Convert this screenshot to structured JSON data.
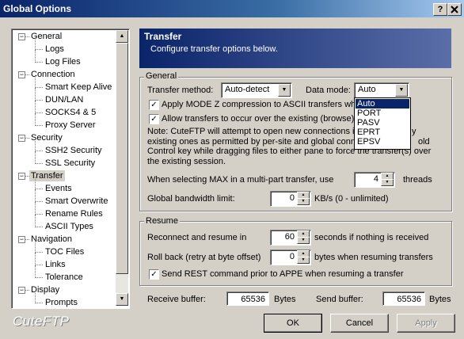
{
  "window": {
    "title": "Global Options",
    "help_glyph": "?",
    "close_glyph": "X"
  },
  "tree": {
    "items": [
      {
        "label": "General",
        "level": 0,
        "expander": "−"
      },
      {
        "label": "Logs",
        "level": 1
      },
      {
        "label": "Log Files",
        "level": 1
      },
      {
        "label": "Connection",
        "level": 0,
        "expander": "−"
      },
      {
        "label": "Smart Keep Alive",
        "level": 1
      },
      {
        "label": "DUN/LAN",
        "level": 1
      },
      {
        "label": "SOCKS4 & 5",
        "level": 1
      },
      {
        "label": "Proxy Server",
        "level": 1
      },
      {
        "label": "Security",
        "level": 0,
        "expander": "−"
      },
      {
        "label": "SSH2 Security",
        "level": 1
      },
      {
        "label": "SSL Security",
        "level": 1
      },
      {
        "label": "Transfer",
        "level": 0,
        "expander": "−",
        "selected": true
      },
      {
        "label": "Events",
        "level": 1
      },
      {
        "label": "Smart Overwrite",
        "level": 1
      },
      {
        "label": "Rename Rules",
        "level": 1
      },
      {
        "label": "ASCII Types",
        "level": 1
      },
      {
        "label": "Navigation",
        "level": 0,
        "expander": "−"
      },
      {
        "label": "TOC Files",
        "level": 1
      },
      {
        "label": "Links",
        "level": 1
      },
      {
        "label": "Tolerance",
        "level": 1
      },
      {
        "label": "Display",
        "level": 0,
        "expander": "−"
      },
      {
        "label": "Prompts",
        "level": 1
      }
    ]
  },
  "brand": "CuteFTP",
  "banner": {
    "title": "Transfer",
    "subtitle": "Configure transfer options below."
  },
  "general": {
    "legend": "General",
    "transfer_method_label": "Transfer method:",
    "transfer_method_value": "Auto-detect",
    "data_mode_label": "Data mode:",
    "data_mode_value": "Auto",
    "data_mode_options": [
      "Auto",
      "PORT",
      "PASV",
      "EPRT",
      "EPSV"
    ],
    "mode_z_label": "Apply MODE Z compression to ASCII transfers whe",
    "mode_z_checked": true,
    "allow_transfers_label": "Allow transfers to occur over the existing (browse)",
    "allow_transfers_checked": true,
    "note_lines": [
      "Note: CuteFTP will attempt to open new connections in",
      "existing ones as permitted by per-site and global conne",
      "Control key while dragging files to either pane to force the transfer(s) over",
      "the existing session."
    ],
    "note_tail_1": "y",
    "note_tail_2": "old",
    "multipart_label": "When selecting MAX in a multi-part transfer, use",
    "multipart_value": "4",
    "multipart_unit": "threads",
    "bandwidth_label": "Global bandwidth limit:",
    "bandwidth_value": "0",
    "bandwidth_unit": "KB/s (0 - unlimited)"
  },
  "resume": {
    "legend": "Resume",
    "reconnect_label": "Reconnect and resume in",
    "reconnect_value": "60",
    "reconnect_unit": "seconds if nothing is received",
    "rollback_label": "Roll back (retry at byte offset)",
    "rollback_value": "0",
    "rollback_unit": "bytes when resuming transfers",
    "rest_label": "Send REST command prior to APPE when resuming a transfer",
    "rest_checked": true
  },
  "buffers": {
    "receive_label": "Receive buffer:",
    "receive_value": "65536",
    "receive_unit": "Bytes",
    "send_label": "Send buffer:",
    "send_value": "65536",
    "send_unit": "Bytes"
  },
  "buttons": {
    "ok": "OK",
    "cancel": "Cancel",
    "apply": "Apply"
  },
  "check_glyph": "✓",
  "arrow_up": "▲",
  "arrow_down": "▼"
}
